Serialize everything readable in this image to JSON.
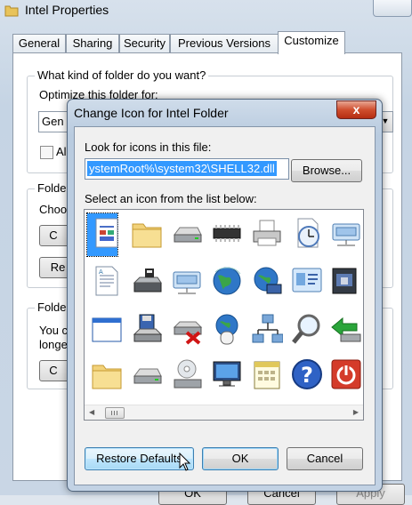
{
  "back_window": {
    "title": "Intel Properties",
    "tabs": [
      "General",
      "Sharing",
      "Security",
      "Previous Versions",
      "Customize"
    ],
    "active_tab": "Customize",
    "group1_label": "What kind of folder do you want?",
    "optimize_label": "Optimize this folder for:",
    "optimize_value": "Gen",
    "also_apply_partial": "Al",
    "group2_label": "Folde",
    "choose_partial": "Choo",
    "btn_c_partial": "C",
    "btn_re_partial": "Re",
    "group3_label": "Folde",
    "you_partial": "You c",
    "longer_partial": "longe",
    "btn_c2_partial": "C",
    "bottom_buttons": [
      "OK",
      "Cancel",
      "Apply"
    ]
  },
  "dialog": {
    "title": "Change Icon for Intel Folder",
    "close_label": "x",
    "look_label": "Look for icons in this file:",
    "path_value": "ystemRoot%\\system32\\SHELL32.dll",
    "browse_label": "Browse...",
    "select_label": "Select an icon from the list below:",
    "restore_label": "Restore Defaults",
    "ok_label": "OK",
    "cancel_label": "Cancel",
    "icons": [
      "blank-document-icon",
      "folder-icon",
      "drive-icon",
      "memory-chip-icon",
      "printer-icon",
      "clock-icon",
      "network-drive-icon",
      "text-document-icon",
      "drive-with-lock-icon",
      "network-drive-icon",
      "globe-icon",
      "network-globe-icon",
      "display-properties-icon",
      "dark-window-icon",
      "window-icon",
      "floppy-drive-icon",
      "drive-error-icon",
      "globe-mouse-icon",
      "network-icon",
      "magnifier-icon",
      "green-arrow-icon",
      "folder-icon",
      "drive-icon",
      "cd-drive-icon",
      "monitor-icon",
      "calendar-icon",
      "help-icon",
      "power-icon"
    ]
  }
}
